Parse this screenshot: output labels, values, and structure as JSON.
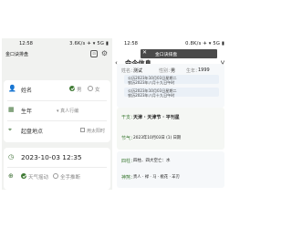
{
  "left": {
    "status": {
      "time": "12:58",
      "icons": "3.6K/s ✈ ▾ 5G ▮"
    },
    "appbar": {
      "title": "金口诀排盘",
      "pin_glyph": "⊡",
      "gear_glyph": "⚙"
    },
    "name_row": {
      "label": "姓名",
      "gender_male": "男",
      "gender_female": "女"
    },
    "year_row": {
      "label": "生年",
      "value": "▾ 真人行编"
    },
    "place_row": {
      "label": "起盘地点",
      "value": "用太阳时"
    },
    "date_row": {
      "value": "2023-10-03 12:35"
    },
    "method_row": {
      "opt1": "天气摇动",
      "opt2": "全手推断"
    }
  },
  "right": {
    "status": {
      "time": "12:58",
      "icons": "0.8K/s ✈ ▾ 5G ▮"
    },
    "popup": {
      "close": "✕",
      "text": "金口诀排盘"
    },
    "header": {
      "back": "‹",
      "title": "命令信息",
      "flag": "V"
    },
    "basic": {
      "name_label": "姓名：",
      "name_value": "测试",
      "sex_label": "性别：",
      "sex_value": "男",
      "birth_label": "生年：",
      "birth_value": "1999"
    },
    "calendar": {
      "line1": "公历2023年10月03日星期二",
      "line2": "农历2023年八月十九日午时",
      "line3": "公历2023年10月03日星期二",
      "line4": "农历2023年八月十九日午时"
    },
    "bazi": {
      "label": "干支：",
      "value": "天津 · 天津节 · 平刊星"
    },
    "solar_term": {
      "label": "节气：",
      "value": "2023年10月03日 (1) 日期"
    },
    "ganzhi": {
      "label": "四柱：",
      "value": "四柱、四大空亡：水"
    },
    "spirits": {
      "label": "神煞：",
      "value": "贵人 · 禄 · 马 · 桃花 · 羊刃"
    }
  }
}
